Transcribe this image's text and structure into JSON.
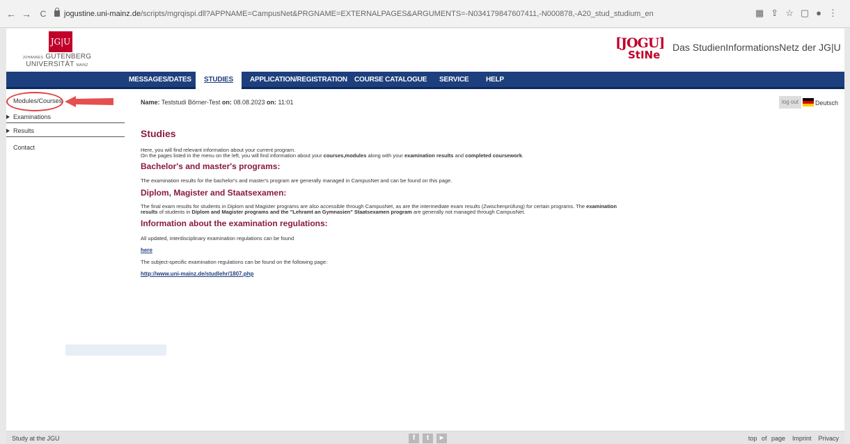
{
  "browser": {
    "url_host": "jogustine.uni-mainz.de",
    "url_path": "/scripts/mgrqispi.dll?APPNAME=CampusNet&PRGNAME=EXTERNALPAGES&ARGUMENTS=-N034179847607411,-N000878,-A20_stud_studium_en",
    "back": "←",
    "forward": "→",
    "reload": "C"
  },
  "header": {
    "jgu_box": "JG|U",
    "jgu_line1_small": "JOHANNES",
    "jgu_line1": "GUTENBERG",
    "jgu_line2": "UNIVERSITÄT",
    "jgu_line2_small": "MAINZ",
    "jogustine_top": "[JOGU]",
    "jogustine_bottom": "StINe",
    "site_title": "Das StudienInformationsNetz der JG|U"
  },
  "topnav": [
    {
      "label": "MESSAGES/DATES"
    },
    {
      "label": "STUDIES"
    },
    {
      "label": "APPLICATION/REGISTRATION"
    },
    {
      "label": "COURSE CATALOGUE"
    },
    {
      "label": "SERVICE"
    },
    {
      "label": "HELP"
    }
  ],
  "sidebar": {
    "items": [
      {
        "label": "Modules/Courses"
      },
      {
        "label": "Examinations"
      },
      {
        "label": "Results"
      },
      {
        "label": "Contact"
      }
    ]
  },
  "main": {
    "name_label": "Name:",
    "name_value": "Teststudi Börner-Test",
    "on_label_1": "on:",
    "date": "08.08.2023",
    "on_label_2": "on:",
    "time": "11:01",
    "logout": "log out",
    "language": "Deutsch",
    "title": "Studies",
    "intro_line1": "Here, you will find relevant information about your current program.",
    "intro_line2_a": "On the pages listed in the menu on the left, you will find information about your",
    "intro_line2_b": "courses,modules",
    "intro_line2_c": "along with your",
    "intro_line2_d": "examination results",
    "intro_line2_e": "and",
    "intro_line2_f": "completed coursework",
    "intro_line2_g": ".",
    "h_bachelor": "Bachelor's and master's programs:",
    "p_bachelor": "The examination results for the bachelor's and master's program are generally managed in CampusNet and can be found on this page.",
    "h_diplom": "Diplom, Magister and Staatsexamen:",
    "p_diplom1_a": "The final exam results for students in Diplom and Magister programs are also accessible through CampusNet, as are the intermediate exam results (Zwischenprüfung) for certain programs. The",
    "p_diplom1_b": "examination",
    "p_diplom2_a": "results",
    "p_diplom2_b": "of students in",
    "p_diplom2_c": "Diplom and Magister programs and the \"Lehramt an Gymnasien\" Staatsexamen program",
    "p_diplom2_d": "are generally not managed through CampusNet.",
    "h_regulations": "Information about the examination regulations:",
    "p_regulations": "All updated, interdisciplinary examination regulations can be found",
    "link_here": "here",
    "p_subject": "The subject-specific examination regulations can be found on the following page:",
    "link_url": "http://www.uni-mainz.de/studlehr/1807.php"
  },
  "footer": {
    "left": "Study at the JGU",
    "social": [
      "f",
      "t",
      "▶"
    ],
    "top_of_page": "top of page",
    "imprint": "Imprint",
    "privacy": "Privacy"
  },
  "colors": {
    "nav_blue": "#1e3f7d",
    "heading_red": "#8a1a3b",
    "brand_red": "#c1002a"
  }
}
